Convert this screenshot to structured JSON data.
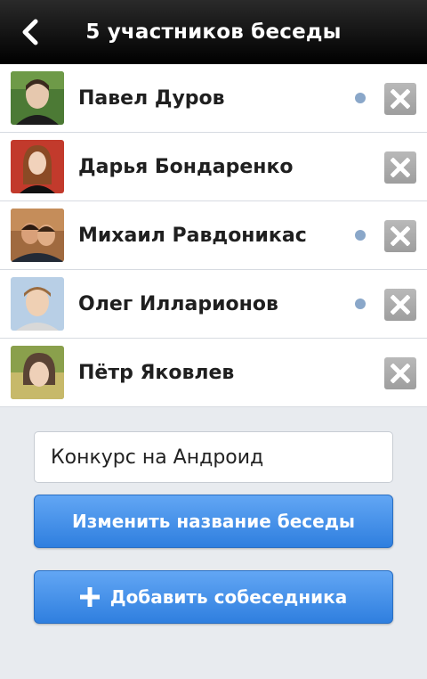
{
  "header": {
    "title": "5 участников беседы",
    "back_icon": "chevron-left-icon"
  },
  "participants": [
    {
      "name": "Павел Дуров",
      "online": true,
      "avatar_color": "#3f6a2e"
    },
    {
      "name": "Дарья Бондаренко",
      "online": false,
      "avatar_color": "#c0392b"
    },
    {
      "name": "Михаил Равдоникас",
      "online": true,
      "avatar_color": "#8a5a3a"
    },
    {
      "name": "Олег Илларионов",
      "online": true,
      "avatar_color": "#8fb2d8"
    },
    {
      "name": "Пётр Яковлев",
      "online": false,
      "avatar_color": "#7a8c3a"
    }
  ],
  "chat": {
    "name_value": "Конкурс на Андроид"
  },
  "actions": {
    "rename_label": "Изменить название беседы",
    "add_label": "Добавить собеседника"
  },
  "colors": {
    "online_dot": "#8aa7c9",
    "button_blue": "#3a86e4"
  }
}
